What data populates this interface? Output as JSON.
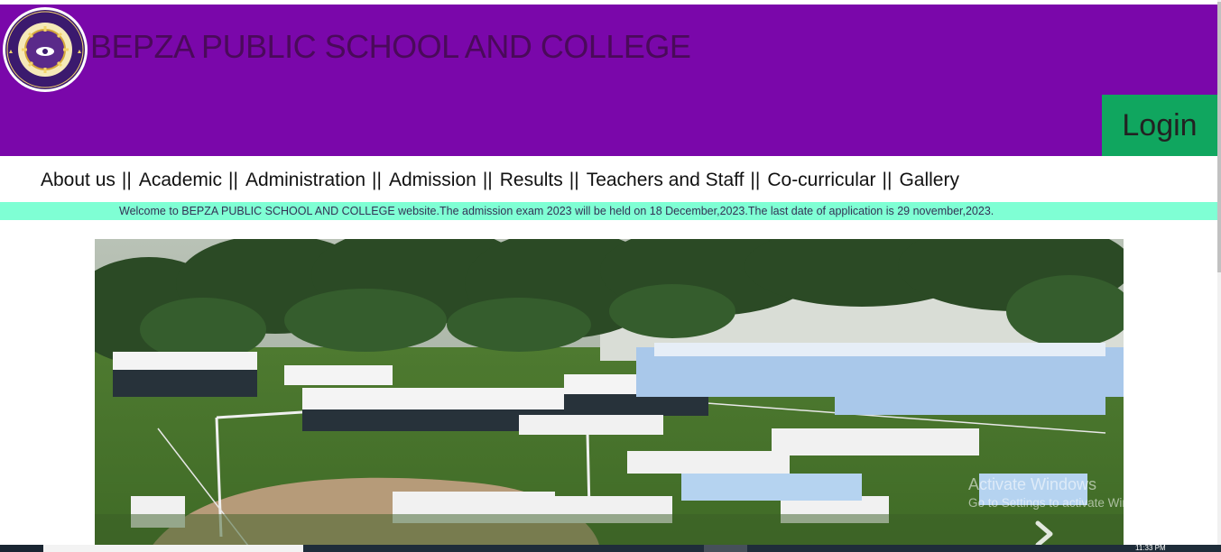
{
  "header": {
    "school_name": "BEPZA PUBLIC SCHOOL AND COLLEGE",
    "login_label": "Login",
    "logo_icon": "school-crest-icon",
    "background_color": "#7a07aa",
    "login_color": "#10a65f"
  },
  "nav": {
    "items": [
      {
        "label": "About us"
      },
      {
        "label": "Academic"
      },
      {
        "label": "Administration"
      },
      {
        "label": "Admission"
      },
      {
        "label": "Results"
      },
      {
        "label": "Teachers and Staff"
      },
      {
        "label": "Co-curricular"
      },
      {
        "label": "Gallery"
      }
    ],
    "separator": "||"
  },
  "notice": {
    "text": "Welcome to BEPZA PUBLIC SCHOOL AND COLLEGE website.The admission exam 2023 will be held on 18 December,2023.The last date of application is 29 november,2023.",
    "background_color": "#7fffd4"
  },
  "slider": {
    "next_icon": "chevron-right-icon"
  },
  "watermark": {
    "title": "Activate Windows",
    "subtitle": "Go to Settings to activate Windows."
  },
  "taskbar": {
    "clock": "11:33 PM"
  }
}
